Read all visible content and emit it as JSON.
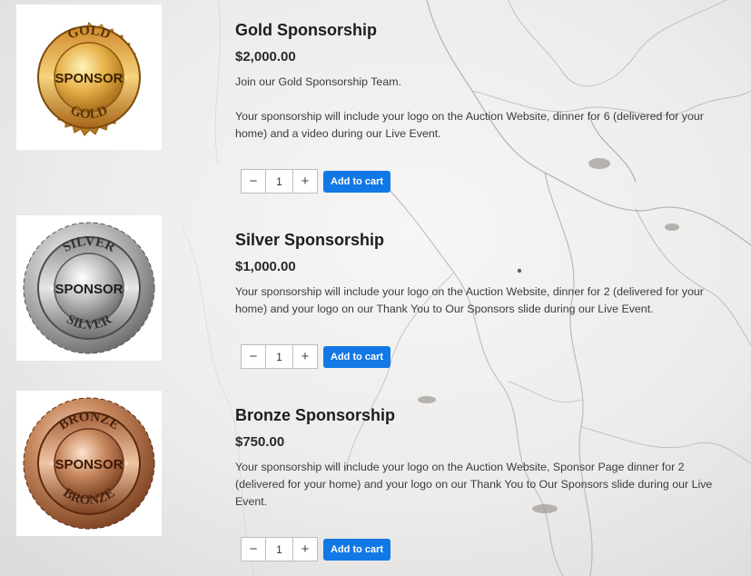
{
  "products": [
    {
      "title": "Gold Sponsorship",
      "price": "$2,000.00",
      "desc": [
        "Join our Gold Sponsorship Team.",
        "Your sponsorship will include your logo on the Auction Website, dinner for 6 (delivered for your home) and a video during our Live Event."
      ],
      "qty": "1",
      "add_label": "Add to cart",
      "badge": {
        "top": "GOLD",
        "center": "SPONSOR",
        "bottom": "GOLD"
      }
    },
    {
      "title": "Silver Sponsorship",
      "price": "$1,000.00",
      "desc": [
        "Your sponsorship will include your logo on the Auction Website, dinner for 2 (delivered for your home) and your logo on our Thank You to Our Sponsors slide during our Live Event."
      ],
      "qty": "1",
      "add_label": "Add to cart",
      "badge": {
        "top": "SILVER",
        "center": "SPONSOR",
        "bottom": "SILVER"
      }
    },
    {
      "title": "Bronze Sponsorship",
      "price": "$750.00",
      "desc": [
        "Your sponsorship will include your logo on the Auction Website, Sponsor Page dinner for 2 (delivered for your home) and your logo on our Thank You to Our Sponsors slide during our Live Event."
      ],
      "qty": "1",
      "add_label": "Add to cart",
      "badge": {
        "top": "BRONZE",
        "center": "SPONSOR",
        "bottom": "BRONZE"
      }
    }
  ],
  "colors": {
    "add_button": "#1278e6",
    "gold": "#e2a93b",
    "silver": "#a8a8a8",
    "bronze": "#c0825a"
  },
  "icons": {
    "minus": "minus-icon",
    "plus": "plus-icon"
  }
}
